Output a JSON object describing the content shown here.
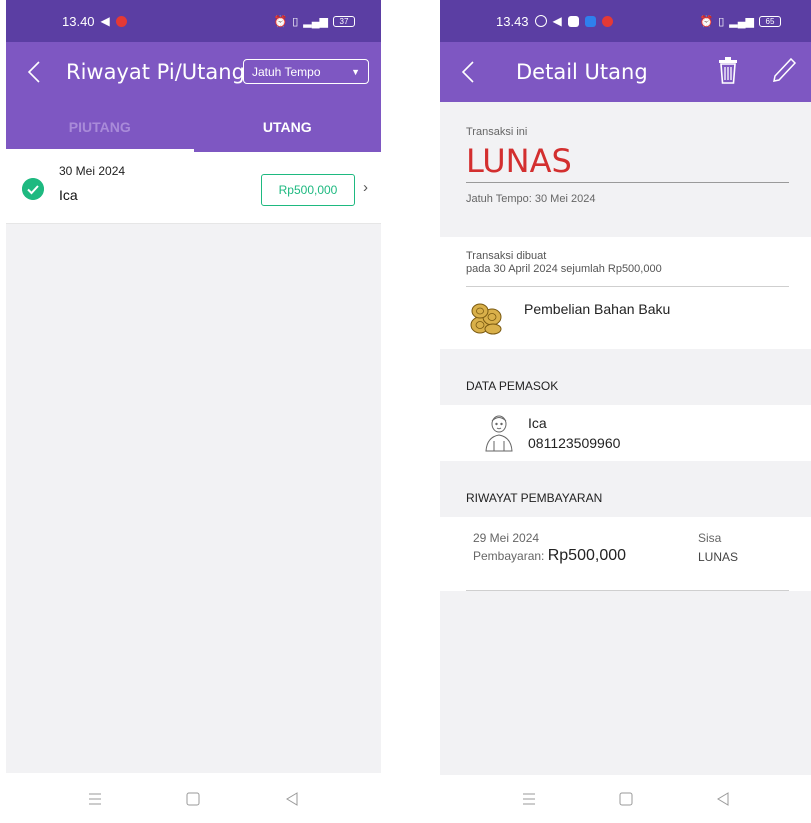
{
  "left_screen": {
    "status_time": "13.40",
    "status_battery": "37",
    "title": "Riwayat Pi/Utang",
    "filter_dropdown": "Jatuh Tempo",
    "tabs": [
      "PIUTANG",
      "UTANG"
    ],
    "active_tab": "UTANG",
    "items": [
      {
        "date": "30 Mei 2024",
        "name": "Ica",
        "amount": "Rp500,000",
        "status_color": "#1eb980"
      }
    ]
  },
  "right_screen": {
    "status_time": "13.43",
    "status_battery": "65",
    "title": "Detail Utang",
    "transaction_label": "Transaksi ini",
    "status": "LUNAS",
    "status_color": "#d32f2f",
    "due_date": "Jatuh Tempo: 30 Mei 2024",
    "created_line1": "Transaksi dibuat",
    "created_line2": "pada 30 April 2024 sejumlah Rp500,000",
    "category": "Pembelian Bahan Baku",
    "supplier_section": "DATA PEMASOK",
    "supplier_name": "Ica",
    "supplier_phone": "081123509960",
    "payment_section": "RIWAYAT PEMBAYARAN",
    "payment": {
      "date": "29 Mei 2024",
      "label": "Pembayaran: ",
      "amount": "Rp500,000",
      "remaining_label": "Sisa",
      "remaining_value": "LUNAS"
    }
  },
  "colors": {
    "header": "#7e57c2",
    "statusbar": "#5b3ea3",
    "accent_green": "#1eb980",
    "background": "#f2f2f4"
  },
  "icons": [
    "back-arrow-icon",
    "dropdown-caret-icon",
    "check-circle-icon",
    "chevron-right-icon",
    "trash-icon",
    "pencil-icon",
    "logs-icon",
    "person-icon",
    "menu-icon",
    "home-icon",
    "back-nav-icon"
  ]
}
